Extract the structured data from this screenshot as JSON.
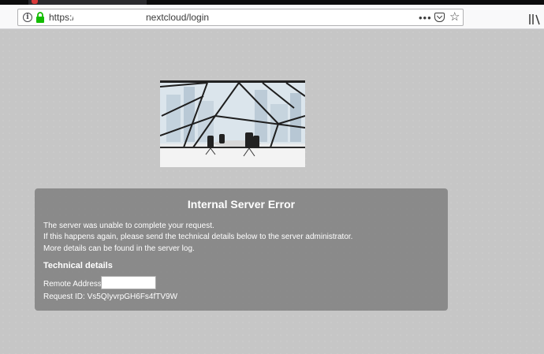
{
  "browser": {
    "url_prefix": "https:/",
    "url_suffix": "nextcloud/login",
    "more_label": "•••"
  },
  "error": {
    "title": "Internal Server Error",
    "lines": [
      "The server was unable to complete your request.",
      "If this happens again, please send the technical details below to the server administrator.",
      "More details can be found in the server log."
    ],
    "technical_title": "Technical details",
    "remote_address_label": "Remote Address:",
    "remote_address_value": "",
    "request_id": "Request ID: Vs5QIyvrpGH6Fs4fTV9W"
  },
  "colors": {
    "page_bg": "#c6c6c6",
    "error_box_bg": "#787878",
    "text": "#ffffff"
  },
  "icons": [
    "info-icon",
    "lock-icon",
    "more-icon",
    "pocket-icon",
    "star-icon",
    "library-icon"
  ]
}
